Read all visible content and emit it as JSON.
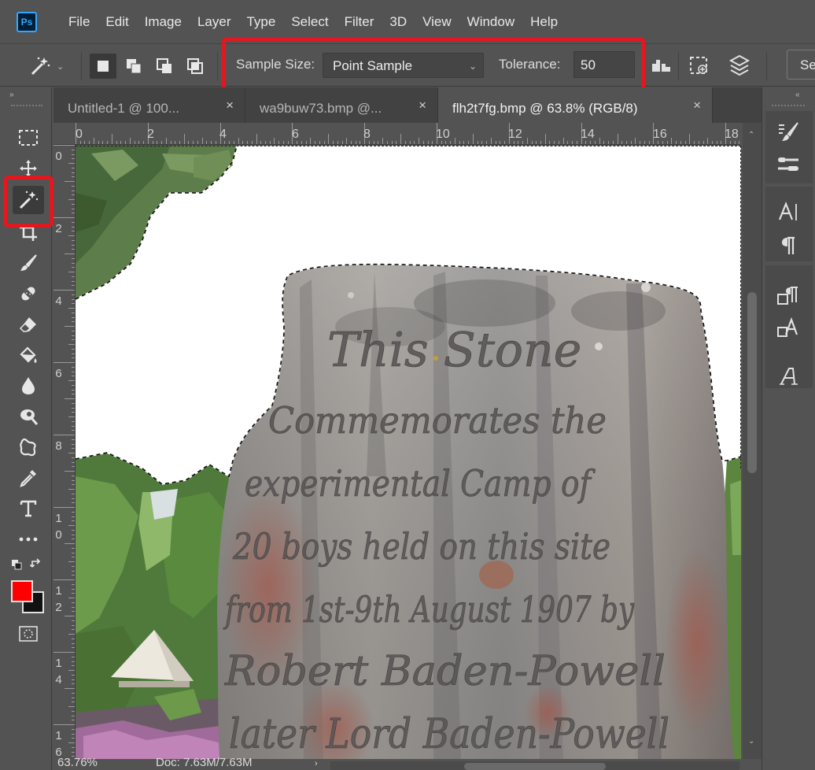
{
  "app": {
    "logo": "Ps"
  },
  "menu": [
    "File",
    "Edit",
    "Image",
    "Layer",
    "Type",
    "Select",
    "Filter",
    "3D",
    "View",
    "Window",
    "Help"
  ],
  "options": {
    "sample_size_label": "Sample Size:",
    "sample_size_value": "Point Sample",
    "tolerance_label": "Tolerance:",
    "tolerance_value": "50",
    "select_subject_label": "Se"
  },
  "tabs": [
    {
      "label": "Untitled-1 @ 100...",
      "close": "×"
    },
    {
      "label": "wa9buw73.bmp @...",
      "close": "×"
    },
    {
      "label": "flh2t7fg.bmp @ 63.8% (RGB/8)",
      "close": "×"
    }
  ],
  "ruler": {
    "top": [
      "0",
      "2",
      "4",
      "6",
      "8",
      "10",
      "12",
      "14",
      "16",
      "18"
    ],
    "left": [
      [
        "0"
      ],
      [
        "2"
      ],
      [
        "4"
      ],
      [
        "6"
      ],
      [
        "8"
      ],
      [
        "1",
        "0"
      ],
      [
        "1",
        "2"
      ],
      [
        "1",
        "4"
      ],
      [
        "1",
        "6"
      ]
    ]
  },
  "canvas": {
    "engraving": [
      "This Stone",
      "Commemorates the",
      "experimental Camp of",
      "20 boys held on this site",
      "from 1st-9th August 1907 by",
      "Robert Baden-Powell",
      "later Lord Baden-Powell"
    ]
  },
  "status": {
    "zoom": "63.76%",
    "doc": "Doc: 7.63M/7.63M"
  },
  "colors": {
    "foreground": "#ff0000",
    "background": "#111111",
    "highlight": "#e3171f"
  },
  "toolbar_icons": [
    "marquee-icon",
    "move-icon",
    "magic-wand-icon",
    "crop-icon",
    "brush-icon",
    "healing-icon",
    "eraser-icon",
    "paint-bucket-icon",
    "blur-icon",
    "smudge-icon",
    "custom-shape-icon",
    "eyedropper-icon",
    "type-icon",
    "more-tools-icon"
  ]
}
